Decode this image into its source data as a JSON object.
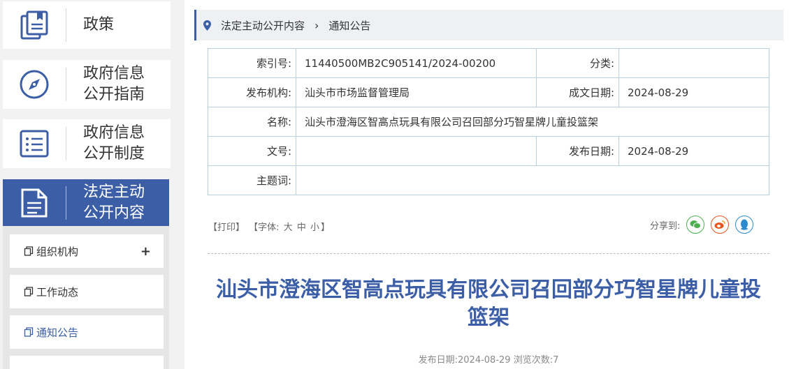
{
  "sidebar": {
    "nav": [
      {
        "label": "政策"
      },
      {
        "label": "政府信息公开指南"
      },
      {
        "label": "政府信息公开制度"
      },
      {
        "label": "法定主动公开内容"
      }
    ],
    "sub": [
      {
        "label": "组织机构",
        "expand": "+"
      },
      {
        "label": "工作动态"
      },
      {
        "label": "通知公告"
      }
    ]
  },
  "breadcrumb": {
    "part1": "法定主动公开内容",
    "part2": "通知公告"
  },
  "meta": {
    "index_label": "索引号:",
    "index_value": "11440500MB2C905141/2024-00200",
    "category_label": "分类:",
    "category_value": "",
    "publisher_label": "发布机构:",
    "publisher_value": "汕头市市场监督管理局",
    "created_label": "成文日期:",
    "created_value": "2024-08-29",
    "name_label": "名称:",
    "name_value": "汕头市澄海区智高点玩具有限公司召回部分巧智星牌儿童投篮架",
    "docno_label": "文号:",
    "docno_value": "",
    "pubdate_label": "发布日期:",
    "pubdate_value": "2024-08-29",
    "keywords_label": "主题词:",
    "keywords_value": ""
  },
  "tools": {
    "print": "【打印】",
    "font_open": "【字体:",
    "large": "大",
    "medium": "中",
    "small": "小",
    "font_close": "】",
    "share_label": "分享到:"
  },
  "article": {
    "title": "汕头市澄海区智高点玩具有限公司召回部分巧智星牌儿童投篮架",
    "pub_label": "发布日期:",
    "pub_date": "2024-08-29",
    "views_label": "浏览次数:",
    "views": "7"
  },
  "colors": {
    "accent": "#3b5ea6",
    "wechat": "#4caf50",
    "weibo": "#e8541e",
    "qq": "#2a8ccf"
  }
}
